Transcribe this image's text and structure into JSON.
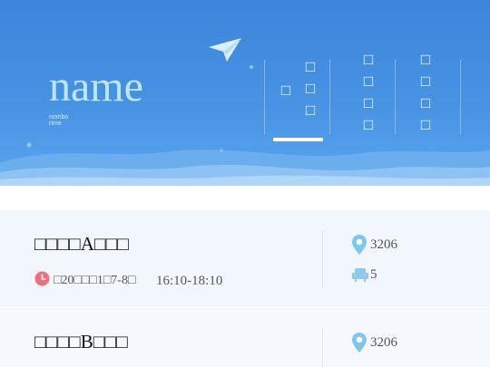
{
  "header": {
    "brand_name": "name",
    "brand_sub_line1": "nombo",
    "brand_sub_line2": "rime",
    "tabs": [
      {
        "label_col1": [
          "□"
        ],
        "label_col2": [
          "□",
          "□",
          "□"
        ],
        "active": true
      },
      {
        "label_col1": [
          "□",
          "□",
          "□",
          "□"
        ],
        "active": false
      },
      {
        "label_col1": [
          "□",
          "□",
          "□",
          "□"
        ],
        "active": false
      }
    ]
  },
  "cards": [
    {
      "title": "□□□□A□□□",
      "location": "3206",
      "seats": "5",
      "date": "□20□□□1□7-8□",
      "time": "16:10-18:10"
    },
    {
      "title": "□□□□B□□□",
      "location": "3206"
    }
  ],
  "colors": {
    "header_gradient_top": "#3d86dc",
    "header_gradient_bottom": "#5aa6ee",
    "brand_name": "#bfe6ff",
    "location_icon": "#7cc6f0",
    "seat_icon": "#8fc8ee",
    "clock_icon": "#f06d7a",
    "card_bg": "#f2f7fd"
  },
  "icons": [
    "paper-plane-icon",
    "location-pin-icon",
    "seat-icon",
    "clock-icon"
  ]
}
